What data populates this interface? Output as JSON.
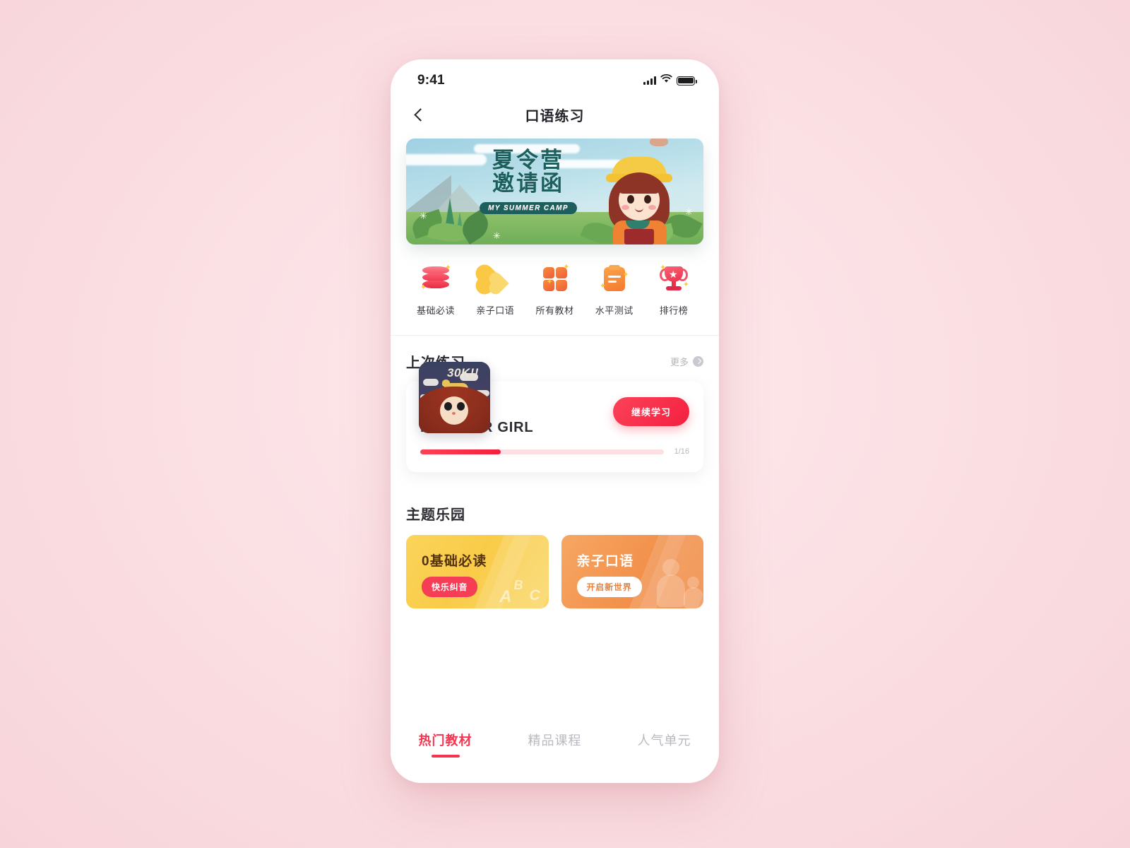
{
  "status_bar": {
    "time": "9:41",
    "signal_icon": "signal-bars-icon",
    "wifi_icon": "wifi-icon",
    "battery_icon": "battery-icon"
  },
  "nav": {
    "back_icon": "chevron-left-icon",
    "title": "口语练习"
  },
  "banner": {
    "title_line1": "夏令营",
    "title_line2": "邀请函",
    "subtitle": "MY SUMMER CAMP",
    "alt": "summer-camp-invitation-banner"
  },
  "quick_icons": [
    {
      "label": "基础必读",
      "icon": "stacked-books-icon"
    },
    {
      "label": "亲子口语",
      "icon": "hearts-icon"
    },
    {
      "label": "所有教材",
      "icon": "grid-icon"
    },
    {
      "label": "水平测试",
      "icon": "clipboard-icon"
    },
    {
      "label": "排行榜",
      "icon": "trophy-icon"
    }
  ],
  "last_practice": {
    "section_title": "上次练习",
    "more_label": "更多",
    "more_icon": "chevron-right-circle-icon",
    "course_title": "RED HAIR GIRL",
    "thumbnail_text": "30K!!",
    "cta_label": "继续学习",
    "progress_label": "1/16",
    "progress_percent": 33
  },
  "theme_park": {
    "section_title": "主题乐园",
    "cards": [
      {
        "title": "0基础必读",
        "badge": "快乐纠音",
        "decor": "abc-letters",
        "color": "#f9cb48"
      },
      {
        "title": "亲子口语",
        "badge": "开启新世界",
        "decor": "parent-child-silhouette",
        "color": "#f2914c"
      }
    ]
  },
  "bottom_tabs": {
    "items": [
      {
        "label": "热门教材",
        "active": true
      },
      {
        "label": "精品课程",
        "active": false
      },
      {
        "label": "人气单元",
        "active": false
      }
    ],
    "accent_color": "#f5354f"
  }
}
